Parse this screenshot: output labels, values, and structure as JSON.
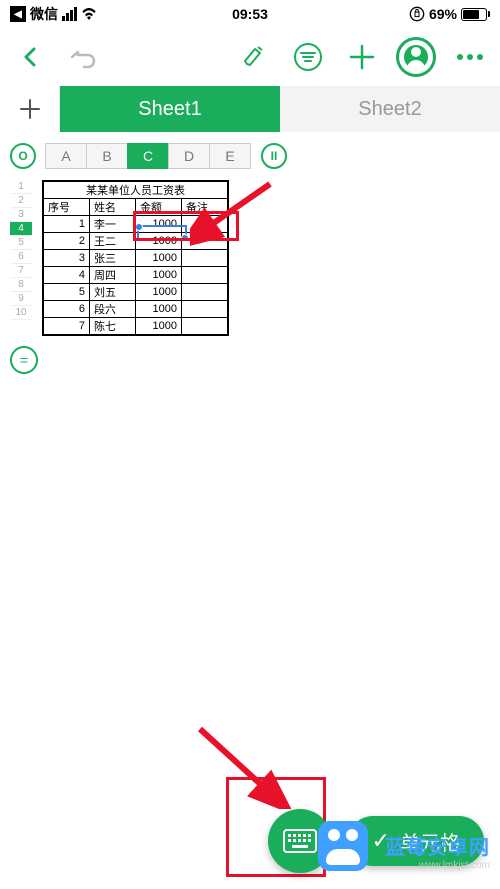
{
  "status": {
    "back_app": "微信",
    "time": "09:53",
    "battery_pct": "69%"
  },
  "tabs": {
    "sheet1": "Sheet1",
    "sheet2": "Sheet2"
  },
  "columns": [
    "A",
    "B",
    "C",
    "D",
    "E"
  ],
  "selected_column_index": 2,
  "row_numbers": [
    "1",
    "2",
    "3",
    "4",
    "5",
    "6",
    "7",
    "8",
    "9",
    "10"
  ],
  "selected_row_index": 3,
  "table": {
    "title": "某某单位人员工资表",
    "headers": [
      "序号",
      "姓名",
      "金额",
      "备注"
    ],
    "rows": [
      {
        "no": "1",
        "name": "李一",
        "amount": "1000",
        "remark": ""
      },
      {
        "no": "2",
        "name": "王二",
        "amount": "1000",
        "remark": ""
      },
      {
        "no": "3",
        "name": "张三",
        "amount": "1000",
        "remark": ""
      },
      {
        "no": "4",
        "name": "周四",
        "amount": "1000",
        "remark": ""
      },
      {
        "no": "5",
        "name": "刘五",
        "amount": "1000",
        "remark": ""
      },
      {
        "no": "6",
        "name": "段六",
        "amount": "1000",
        "remark": ""
      },
      {
        "no": "7",
        "name": "陈七",
        "amount": "1000",
        "remark": ""
      }
    ]
  },
  "selected_cell_value": "1000",
  "floating": {
    "cell_label": "单元格"
  },
  "watermark": {
    "line1": "蓝莓安卓网",
    "line2": "www.lmkjst.com"
  },
  "icons": {
    "formula": "=",
    "record": "O",
    "pause": "II",
    "check": "✓"
  },
  "colors": {
    "accent": "#1aad5b",
    "annotation": "#e8112a",
    "selection": "#3b7ddd"
  }
}
